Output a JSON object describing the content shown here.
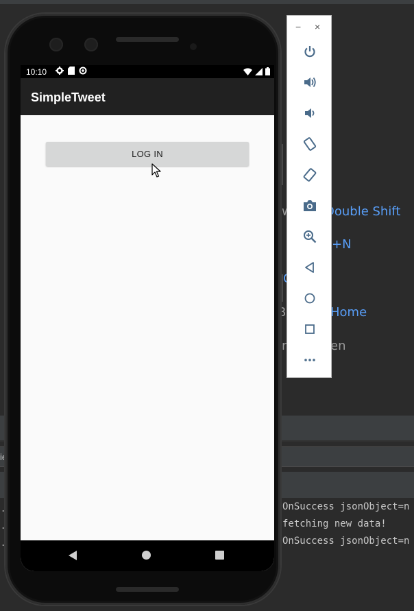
{
  "ide": {
    "shortcuts": [
      {
        "prefix": "w",
        "link": "Double Shift"
      },
      {
        "prefix": "",
        "link": "+N"
      },
      {
        "prefix": "",
        "link": "C"
      },
      {
        "prefix": "Ba",
        "link": "Home"
      },
      {
        "prefix": "r",
        "text": "en"
      }
    ],
    "log_lines": [
      "OnSuccess jsonObject=n",
      "fetching new data!",
      "OnSuccess jsonObject=n"
    ],
    "side_label": "ie"
  },
  "device": {
    "status_bar": {
      "time": "10:10",
      "left_icons": [
        "gear-icon",
        "sd-card-icon",
        "data-saver-icon"
      ],
      "right_icons": [
        "wifi-icon",
        "signal-icon",
        "battery-icon"
      ]
    },
    "app_bar": {
      "title": "SimpleTweet"
    },
    "login_button": {
      "label": "LOG IN"
    },
    "nav": [
      "back-icon",
      "home-icon",
      "recents-icon"
    ]
  },
  "emulator_toolbar": {
    "window_controls": {
      "minimize": "−",
      "close": "×"
    },
    "buttons": [
      "power-icon",
      "volume-up-icon",
      "volume-down-icon",
      "rotate-left-icon",
      "rotate-right-icon",
      "camera-icon",
      "zoom-icon",
      "back-icon",
      "home-icon",
      "overview-icon",
      "more-icon"
    ]
  },
  "colors": {
    "ide_background": "#2b2b2b",
    "ide_link": "#589df6",
    "app_bar": "#212121",
    "button": "#d6d7d7",
    "toolbar_icon": "#4a6b8a"
  }
}
